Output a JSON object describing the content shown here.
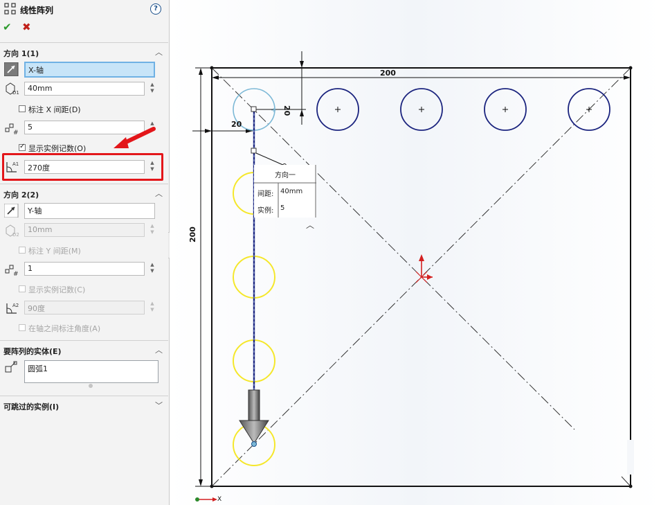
{
  "panel": {
    "title": "线性阵列",
    "help": "?",
    "ok": "✔",
    "cancel": "✖"
  },
  "direction1": {
    "header": "方向 1(1)",
    "axis": "X-轴",
    "spacing": "40mm",
    "dim_spacing_label": "标注 X 间距(D)",
    "instances": "5",
    "show_count_label": "显示实例记数(O)",
    "angle": "270度"
  },
  "direction2": {
    "header": "方向 2(2)",
    "axis": "Y-轴",
    "spacing": "10mm",
    "dim_spacing_label": "标注 Y 间距(M)",
    "instances": "1",
    "show_count_label": "显示实例记数(C)",
    "angle": "90度",
    "dim_angle_label": "在轴之间标注角度(A)"
  },
  "entities": {
    "header": "要阵列的实体(E)",
    "item": "圆弧1"
  },
  "skip": {
    "header": "可跳过的实例(I)"
  },
  "callout": {
    "title": "方向一",
    "spacing_label": "间距:",
    "spacing_value": "40mm",
    "instances_label": "实例:",
    "instances_value": "5"
  },
  "dims": {
    "top_width": "200",
    "left_height": "200",
    "offset_x": "20",
    "offset_y": "20"
  },
  "triad": {
    "x_label": "X"
  },
  "colors": {
    "highlight": "#e3161a",
    "circle": "#1a237e",
    "preview": "#f5e72a",
    "selection": "#7cb8d6",
    "origin": "#d32020"
  }
}
